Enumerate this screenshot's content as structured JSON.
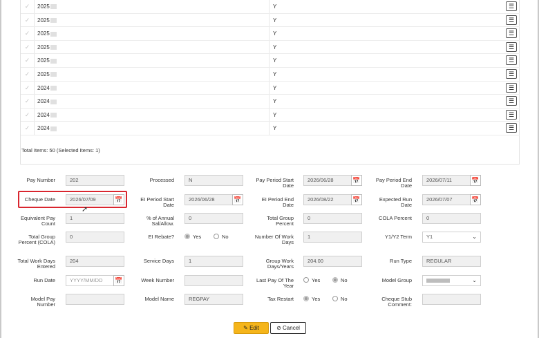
{
  "grid": {
    "rows": [
      {
        "year": "2025",
        "flag": "Y"
      },
      {
        "year": "2025",
        "flag": "Y"
      },
      {
        "year": "2025",
        "flag": "Y"
      },
      {
        "year": "2025",
        "flag": "Y"
      },
      {
        "year": "2025",
        "flag": "Y"
      },
      {
        "year": "2025",
        "flag": "Y"
      },
      {
        "year": "2024",
        "flag": "Y"
      },
      {
        "year": "2024",
        "flag": "Y"
      },
      {
        "year": "2024",
        "flag": "Y"
      },
      {
        "year": "2024",
        "flag": "Y"
      }
    ],
    "check_glyph": "✓",
    "row_button_glyph": "☰",
    "totals": "Total Items: 50 (Selected Items: 1)"
  },
  "form": {
    "pay_number": {
      "label": "Pay Number",
      "value": "202"
    },
    "processed": {
      "label": "Processed",
      "value": "N"
    },
    "pay_period_start": {
      "label": "Pay Period Start Date",
      "value": "2026/06/28"
    },
    "pay_period_end": {
      "label": "Pay Period End Date",
      "value": "2026/07/11"
    },
    "cheque_date": {
      "label": "Cheque Date",
      "value": "2026/07/09"
    },
    "ei_period_start": {
      "label": "EI Period Start Date",
      "value": "2026/06/28"
    },
    "ei_period_end": {
      "label": "EI Period End Date",
      "value": "2026/08/22"
    },
    "expected_run_date": {
      "label": "Expected Run Date",
      "value": "2026/07/07"
    },
    "equiv_pay_count": {
      "label": "Equivalent Pay Count",
      "value": "1"
    },
    "pct_annual": {
      "label": "% of Annual Sal/Allow.",
      "value": "0"
    },
    "total_group_pct": {
      "label": "Total Group Percent",
      "value": "0"
    },
    "cola_pct": {
      "label": "COLA Percent",
      "value": "0"
    },
    "total_group_pct_cola": {
      "label": "Total Group Percent (COLA)",
      "value": "0"
    },
    "ei_rebate": {
      "label": "EI Rebate?",
      "yes": "Yes",
      "no": "No"
    },
    "num_work_days": {
      "label": "Number Of Work Days",
      "value": "1"
    },
    "y1y2_term": {
      "label": "Y1/Y2 Term",
      "value": "Y1"
    },
    "total_work_days": {
      "label": "Total Work Days Entered",
      "value": "204"
    },
    "service_days": {
      "label": "Service Days",
      "value": "1"
    },
    "group_work_days": {
      "label": "Group Work Days/Years",
      "value": "204.00"
    },
    "run_type": {
      "label": "Run Type",
      "value": "REGULAR"
    },
    "run_date": {
      "label": "Run Date",
      "placeholder": "YYYY/MM/DD"
    },
    "week_number": {
      "label": "Week Number",
      "value": ""
    },
    "last_pay_of_year": {
      "label": "Last Pay Of The Year",
      "yes": "Yes",
      "no": "No"
    },
    "model_group": {
      "label": "Model Group"
    },
    "model_pay_number": {
      "label": "Model Pay Number",
      "value": ""
    },
    "model_name": {
      "label": "Model Name",
      "value": "REGPAY"
    },
    "tax_restart": {
      "label": "Tax Restart",
      "yes": "Yes",
      "no": "No"
    },
    "cheque_stub_comment": {
      "label": "Cheque Stub Comment:",
      "value": ""
    }
  },
  "icons": {
    "calendar": "📅",
    "chevron": "⌄"
  },
  "buttons": {
    "edit": "Edit",
    "edit_icon": "✎",
    "cancel": "Cancel",
    "cancel_icon": "⊘"
  }
}
